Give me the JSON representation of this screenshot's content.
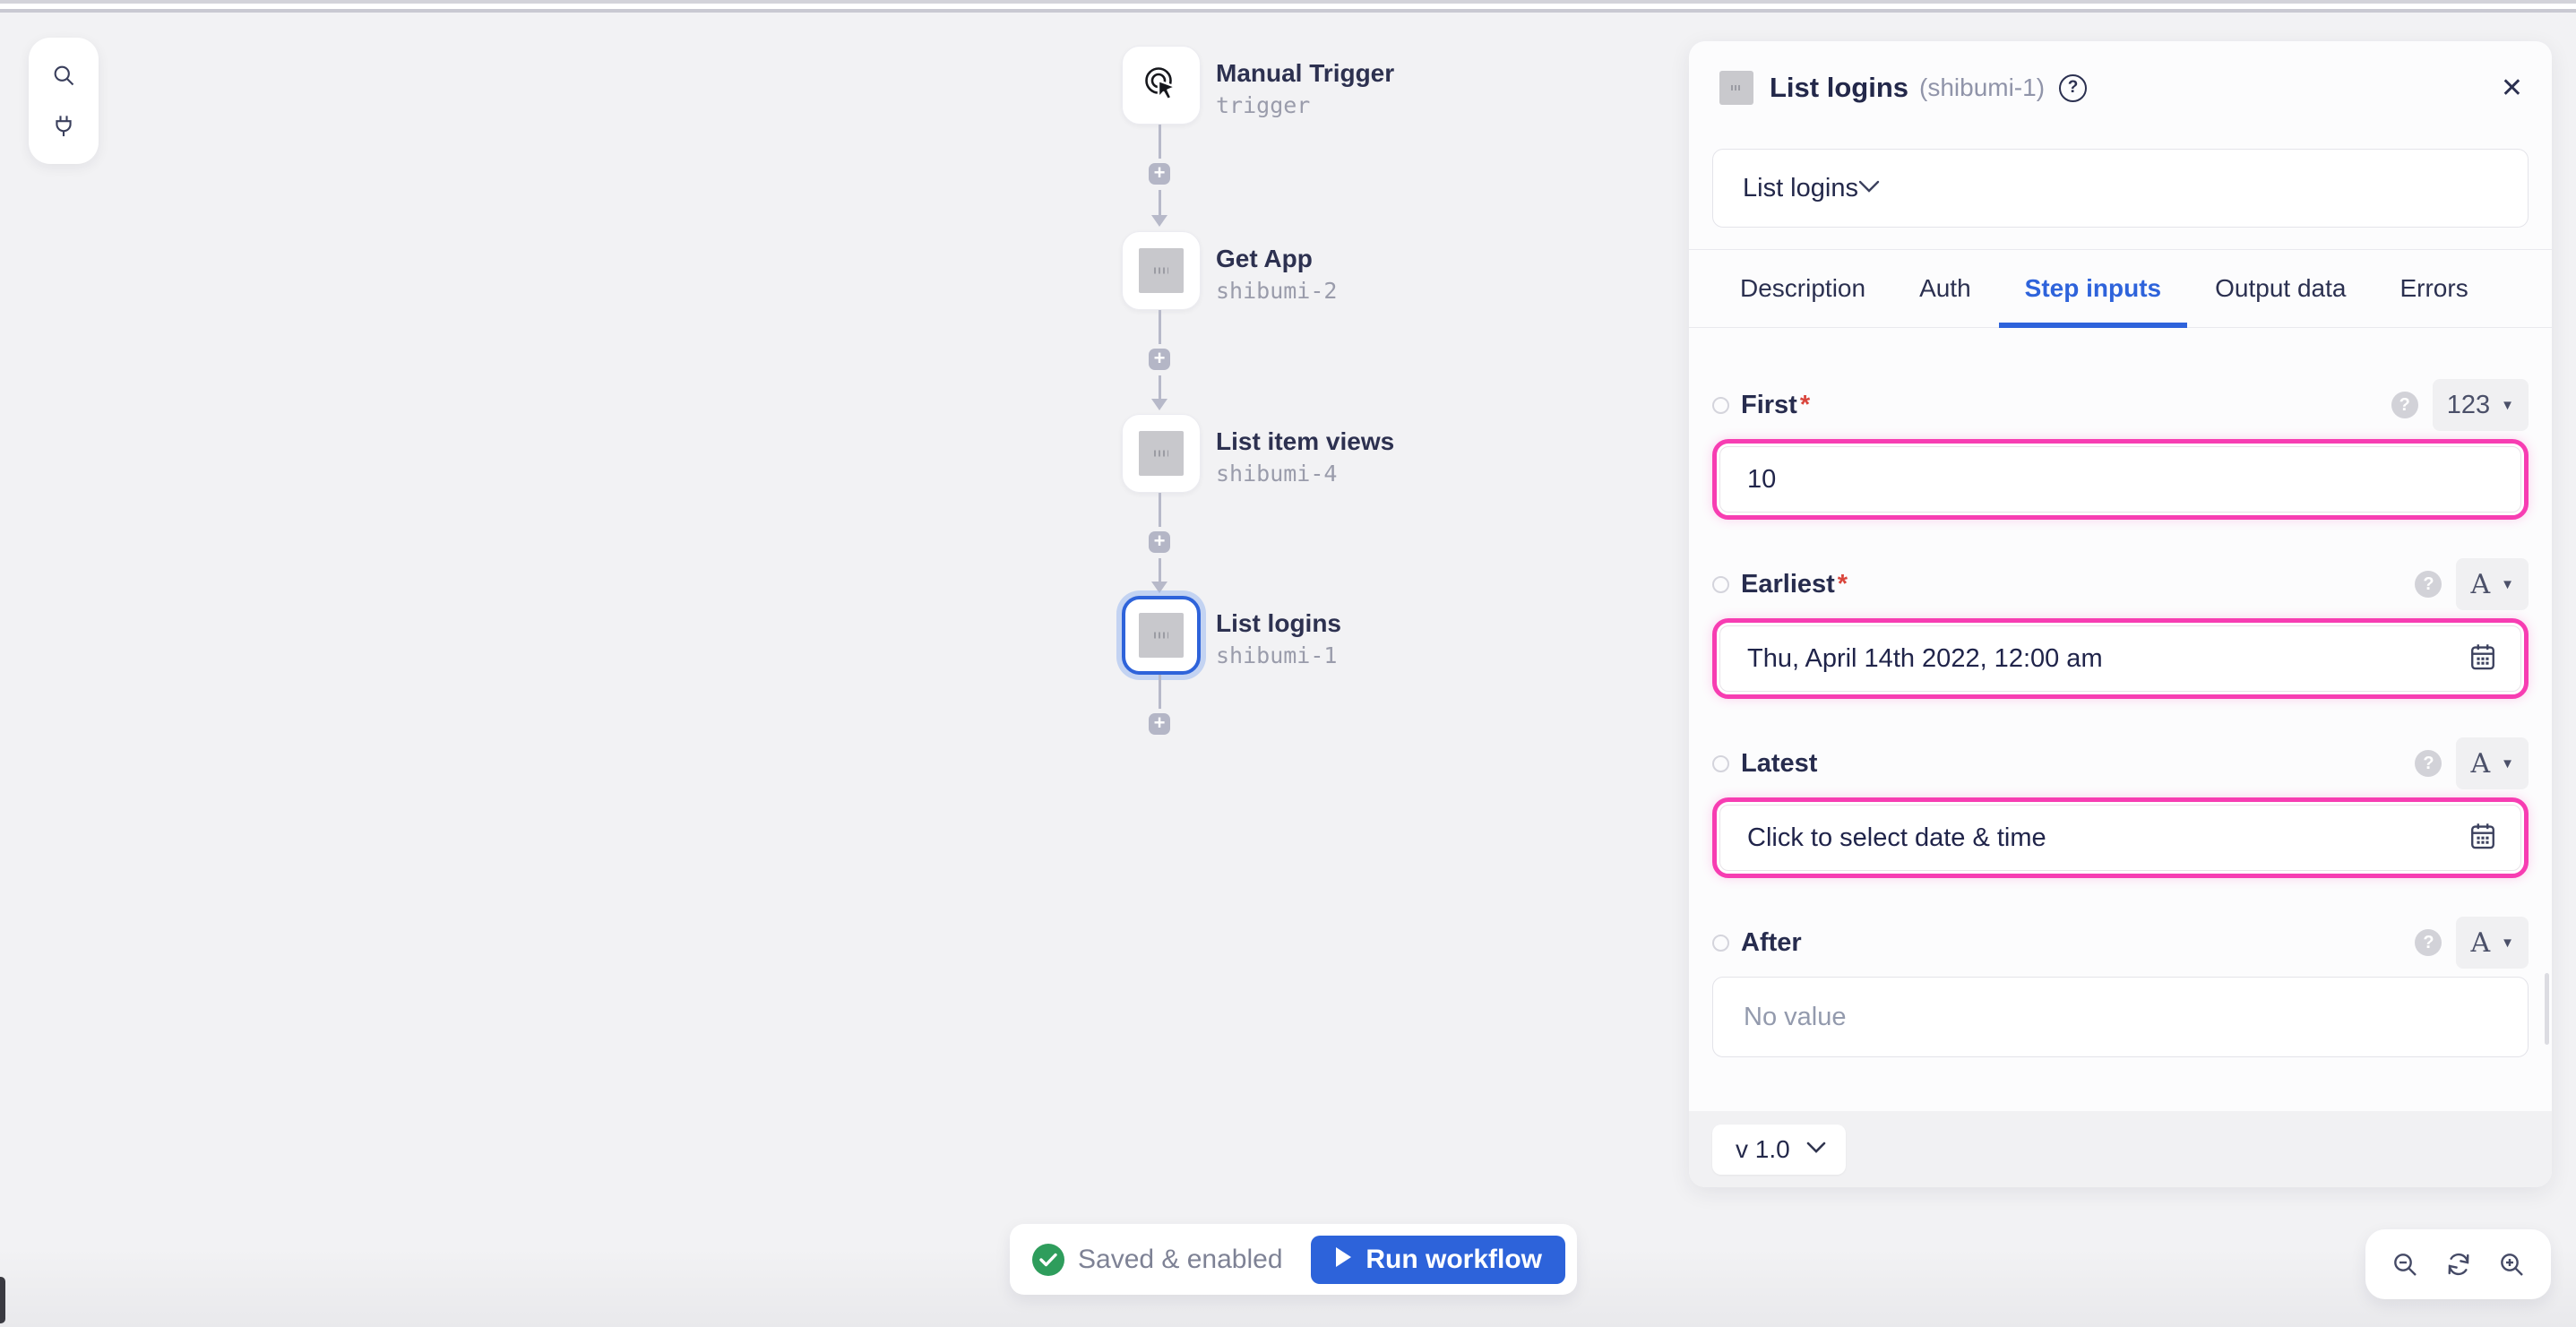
{
  "glyphs": {
    "plus": "+",
    "question_mark": "?",
    "close": "✕",
    "caret_down": "▼",
    "asterisk": "*"
  },
  "colors": {
    "accent_pink": "#f73db2",
    "accent_blue": "#2d63da",
    "success_green": "#2e9d5c",
    "canvas_bg": "#f2f2f4",
    "panel_bg": "#fcfcfd",
    "text_dark": "#23284a",
    "text_gray": "#9a9cab"
  },
  "canvas": {
    "toolbar_icons": [
      "search-icon",
      "plug-icon"
    ],
    "nodes": [
      {
        "title": "Manual Trigger",
        "subtitle": "trigger",
        "selected": false
      },
      {
        "title": "Get App",
        "subtitle": "shibumi-2",
        "selected": false
      },
      {
        "title": "List item views",
        "subtitle": "shibumi-4",
        "selected": false
      },
      {
        "title": "List logins",
        "subtitle": "shibumi-1",
        "selected": true
      }
    ],
    "statusbar": {
      "saved_label": "Saved & enabled",
      "run_label": "Run workflow"
    },
    "zoom_icons": [
      "zoom-out-icon",
      "refresh-icon",
      "zoom-in-icon"
    ]
  },
  "panel": {
    "title": "List logins",
    "subtitle": "(shibumi-1)",
    "action_select": {
      "value": "List logins"
    },
    "tabs": [
      {
        "label": "Description",
        "active": false
      },
      {
        "label": "Auth",
        "active": false
      },
      {
        "label": "Step inputs",
        "active": true
      },
      {
        "label": "Output data",
        "active": false
      },
      {
        "label": "Errors",
        "active": false
      }
    ],
    "fields": [
      {
        "label": "First",
        "required": true,
        "type_badge": "123",
        "value": "10",
        "highlighted": true
      },
      {
        "label": "Earliest",
        "required": true,
        "type_badge": "A",
        "value": "Thu, April 14th 2022, 12:00 am",
        "highlighted": true
      },
      {
        "label": "Latest",
        "required": false,
        "type_badge": "A",
        "value": "Click to select date & time",
        "highlighted": true
      },
      {
        "label": "After",
        "required": false,
        "type_badge": "A",
        "value": "",
        "placeholder": "No value",
        "highlighted": false
      }
    ],
    "version_label": "v 1.0"
  }
}
